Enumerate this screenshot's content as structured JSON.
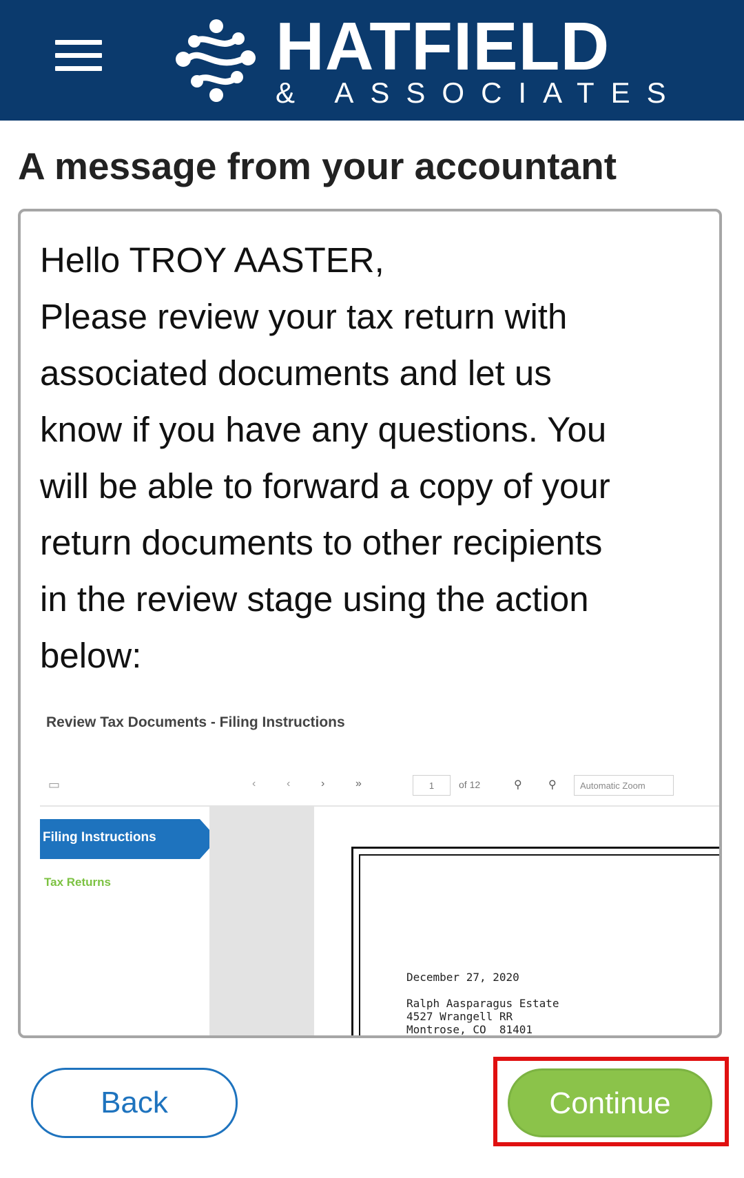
{
  "header": {
    "brand_name": "HATFIELD",
    "brand_sub": "& ASSOCIATES",
    "bg_color": "#0b3a6d",
    "menu_icon": "hamburger-menu-icon"
  },
  "page_title": "A message from your accountant",
  "message": {
    "lines": [
      "Hello TROY AASTER,",
      "Please review your tax return with",
      "associated documents and let us",
      "know if you have any questions. You",
      "will be able to forward a copy of your",
      "return documents to other recipients",
      "in the review stage using the action",
      "below:"
    ]
  },
  "embedded_screenshot": {
    "title": "Review Tax Documents - Filing Instructions",
    "page_number": "1",
    "page_count": "of 12",
    "zoom": "Automatic Zoom",
    "sidebar_active": "Filing Instructions",
    "sidebar_link": "Tax Returns",
    "doc_lines": [
      "December 27, 2020",
      "",
      "Ralph Aasparagus Estate",
      "4527 Wrangell RR",
      "Montrose, CO  81401"
    ]
  },
  "buttons": {
    "back": "Back",
    "continue": "Continue"
  },
  "colors": {
    "accent_blue": "#1e73be",
    "continue_green": "#8bc34a",
    "highlight_red": "#e01010"
  }
}
